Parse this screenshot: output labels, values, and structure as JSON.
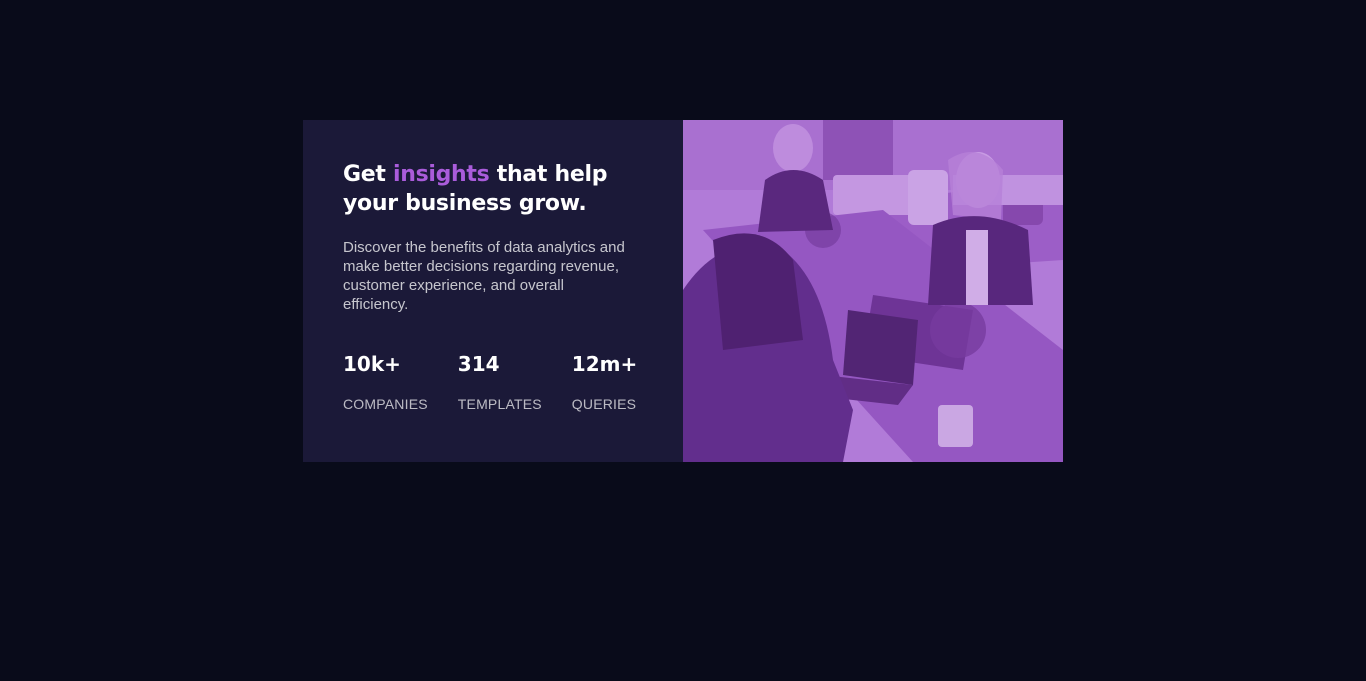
{
  "card": {
    "heading": {
      "before": "Get ",
      "accent": "insights",
      "after": " that help your business grow."
    },
    "description": "Discover the benefits of data analytics and make better decisions regarding revenue, customer experience, and overall efficiency.",
    "stats": [
      {
        "value": "10k+",
        "label": "COMPANIES"
      },
      {
        "value": "314",
        "label": "TEMPLATES"
      },
      {
        "value": "12m+",
        "label": "QUERIES"
      }
    ]
  },
  "colors": {
    "page_background": "#090b1a",
    "card_background": "#1b1938",
    "accent": "#aa5cdb",
    "image_overlay": "#8d3ec2"
  },
  "image": {
    "subject": "people-working-at-office-table-photo"
  }
}
